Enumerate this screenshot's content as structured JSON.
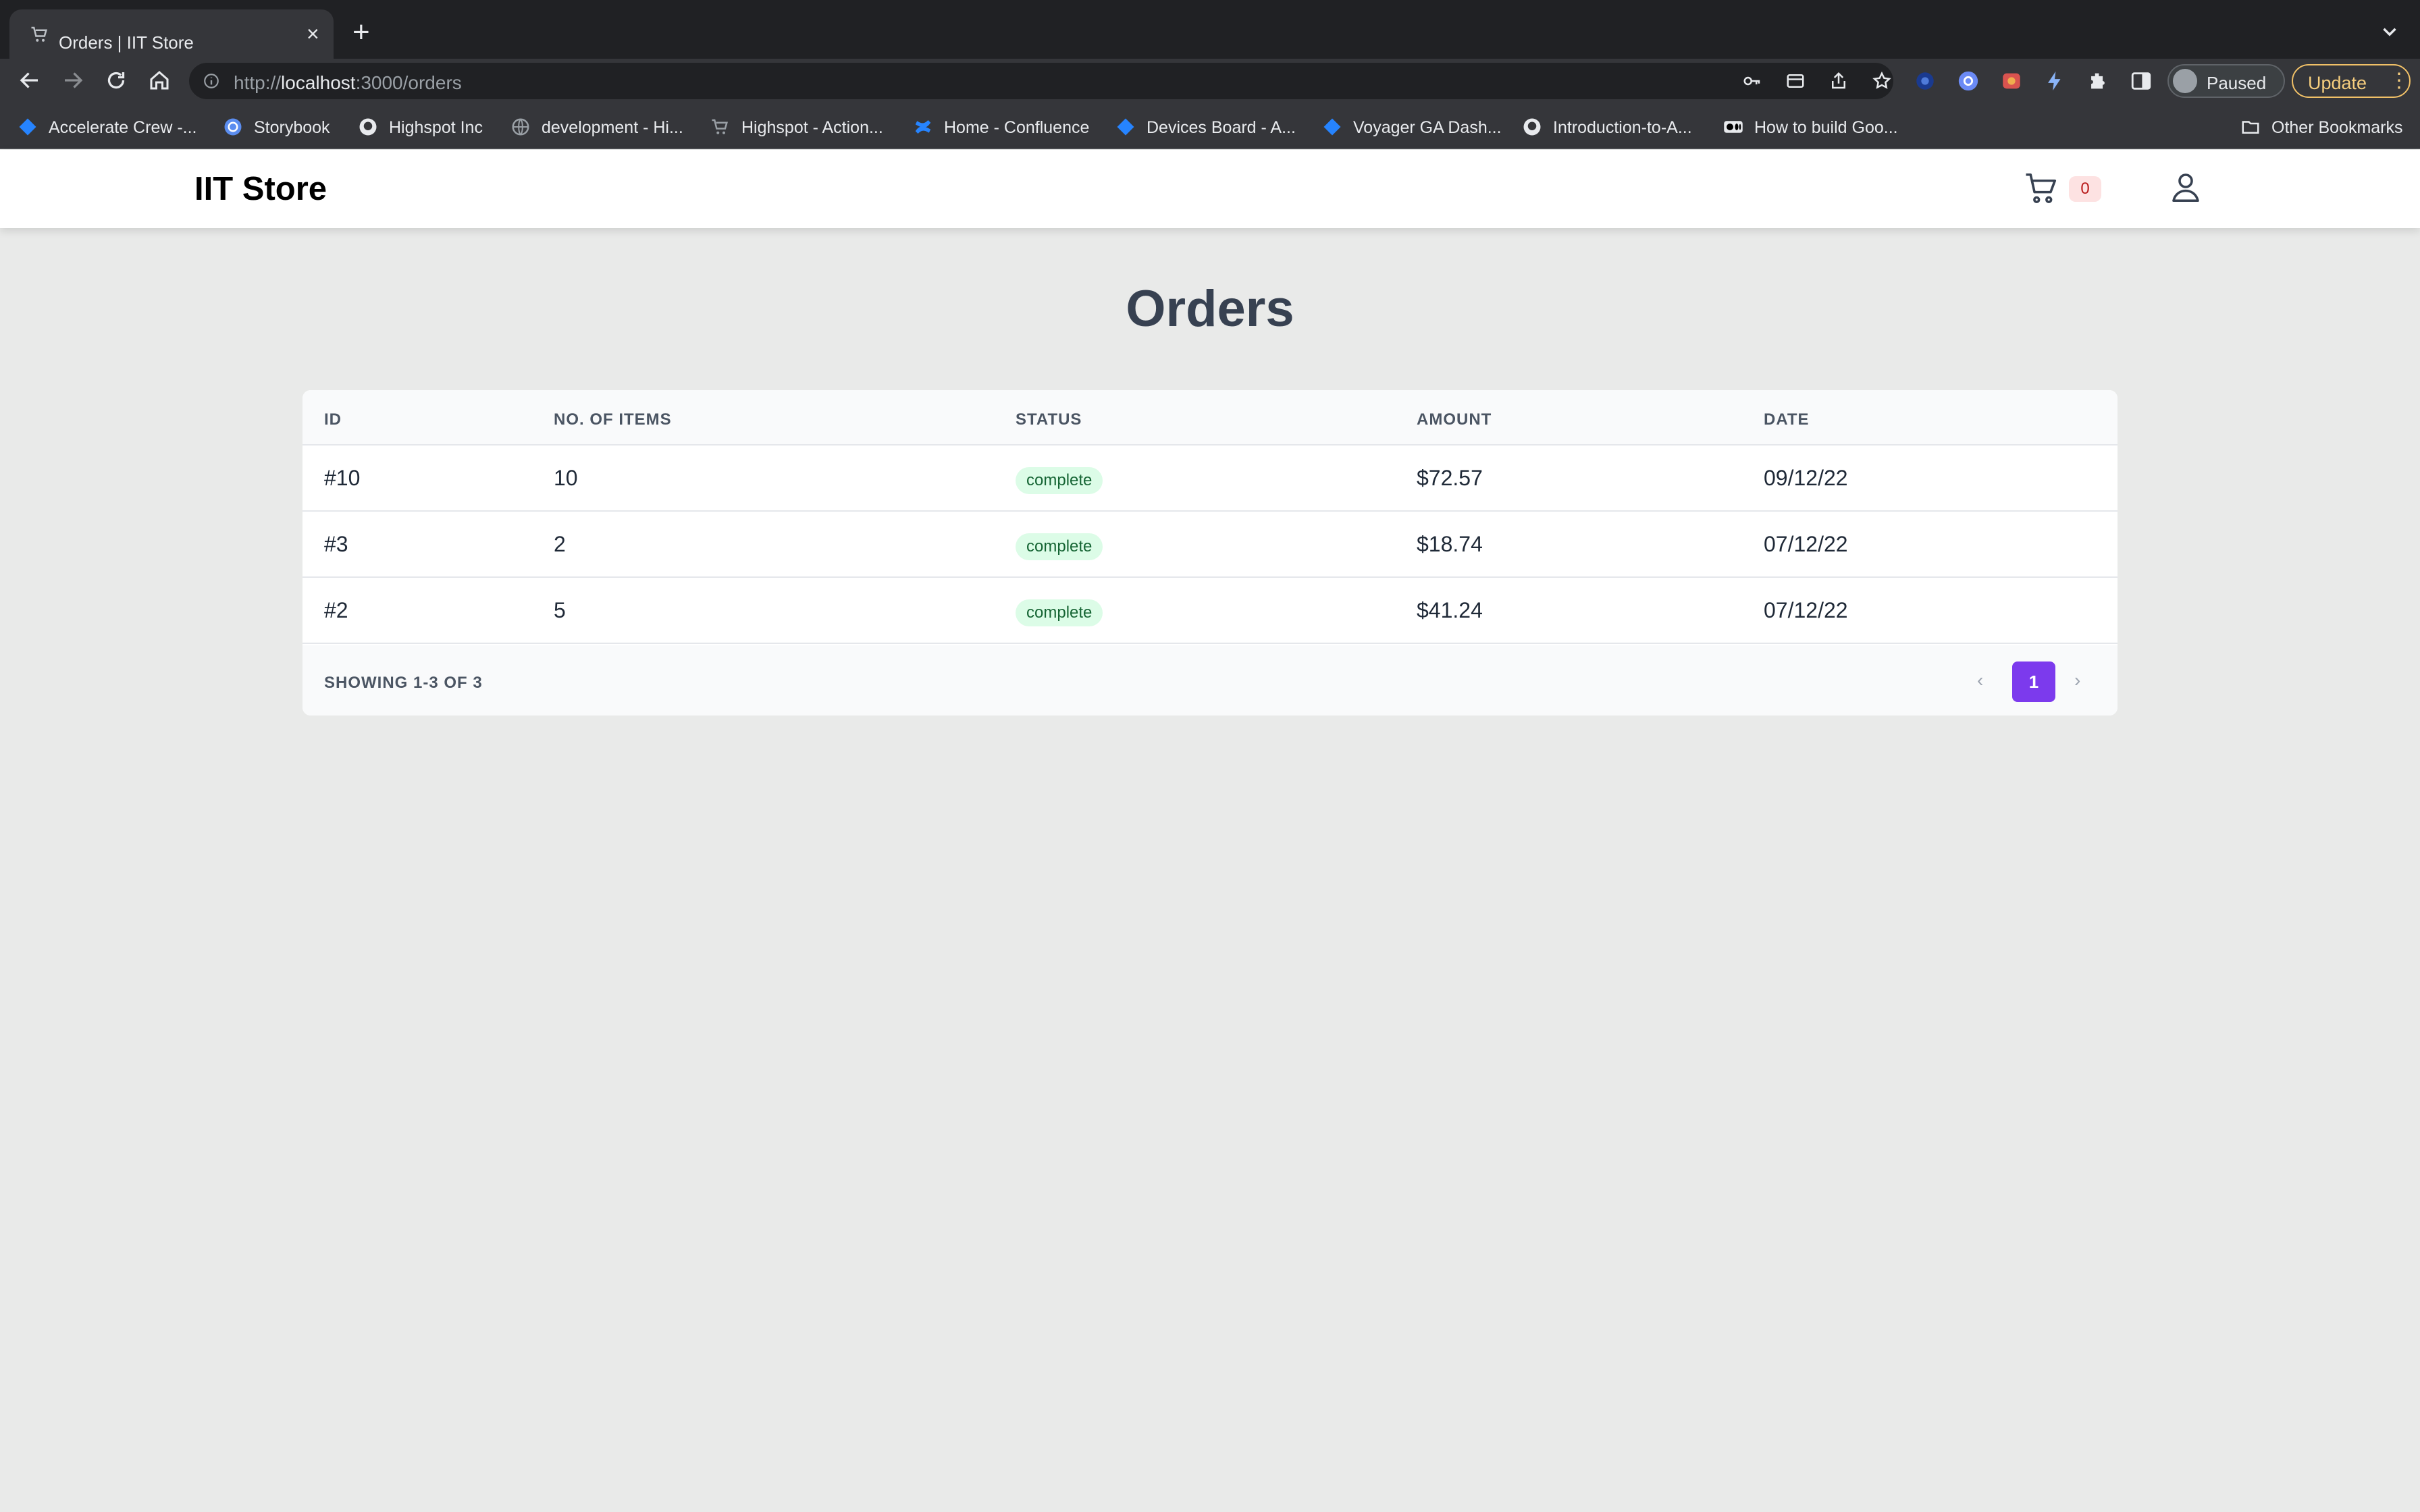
{
  "browser": {
    "tab_title": "Orders | IIT Store",
    "url_scheme": "http://",
    "url_host": "localhost",
    "url_path": ":3000/orders",
    "profile_label": "Paused",
    "update_label": "Update",
    "bookmarks": [
      {
        "label": "Accelerate Crew -...",
        "icon": "jira-icon"
      },
      {
        "label": "Storybook",
        "icon": "storybook-icon"
      },
      {
        "label": "Highspot Inc",
        "icon": "github-icon"
      },
      {
        "label": "development - Hi...",
        "icon": "globe-icon"
      },
      {
        "label": "Highspot - Action...",
        "icon": "cart-icon"
      },
      {
        "label": "Home - Confluence",
        "icon": "confluence-icon"
      },
      {
        "label": "Devices Board - A...",
        "icon": "jira-icon"
      },
      {
        "label": "Voyager GA Dash...",
        "icon": "jira-icon"
      },
      {
        "label": "Introduction-to-A...",
        "icon": "github-icon"
      },
      {
        "label": "How to build Goo...",
        "icon": "medium-icon"
      }
    ],
    "other_bookmarks": "Other Bookmarks"
  },
  "header": {
    "brand": "IIT Store",
    "cart_count": "0"
  },
  "page": {
    "title": "Orders"
  },
  "table": {
    "columns": [
      "ID",
      "NO. OF ITEMS",
      "STATUS",
      "AMOUNT",
      "DATE"
    ],
    "rows": [
      {
        "id": "#10",
        "items": "10",
        "status": "complete",
        "amount": "$72.57",
        "date": "09/12/22"
      },
      {
        "id": "#3",
        "items": "2",
        "status": "complete",
        "amount": "$18.74",
        "date": "07/12/22"
      },
      {
        "id": "#2",
        "items": "5",
        "status": "complete",
        "amount": "$41.24",
        "date": "07/12/22"
      }
    ],
    "footer": {
      "showing": "SHOWING 1-3 OF 3",
      "current_page": "1",
      "prev": "‹",
      "next": "›"
    }
  },
  "colors": {
    "accent": "#7c3aed",
    "status_complete_bg": "#dcfce7",
    "status_complete_text": "#166534"
  }
}
